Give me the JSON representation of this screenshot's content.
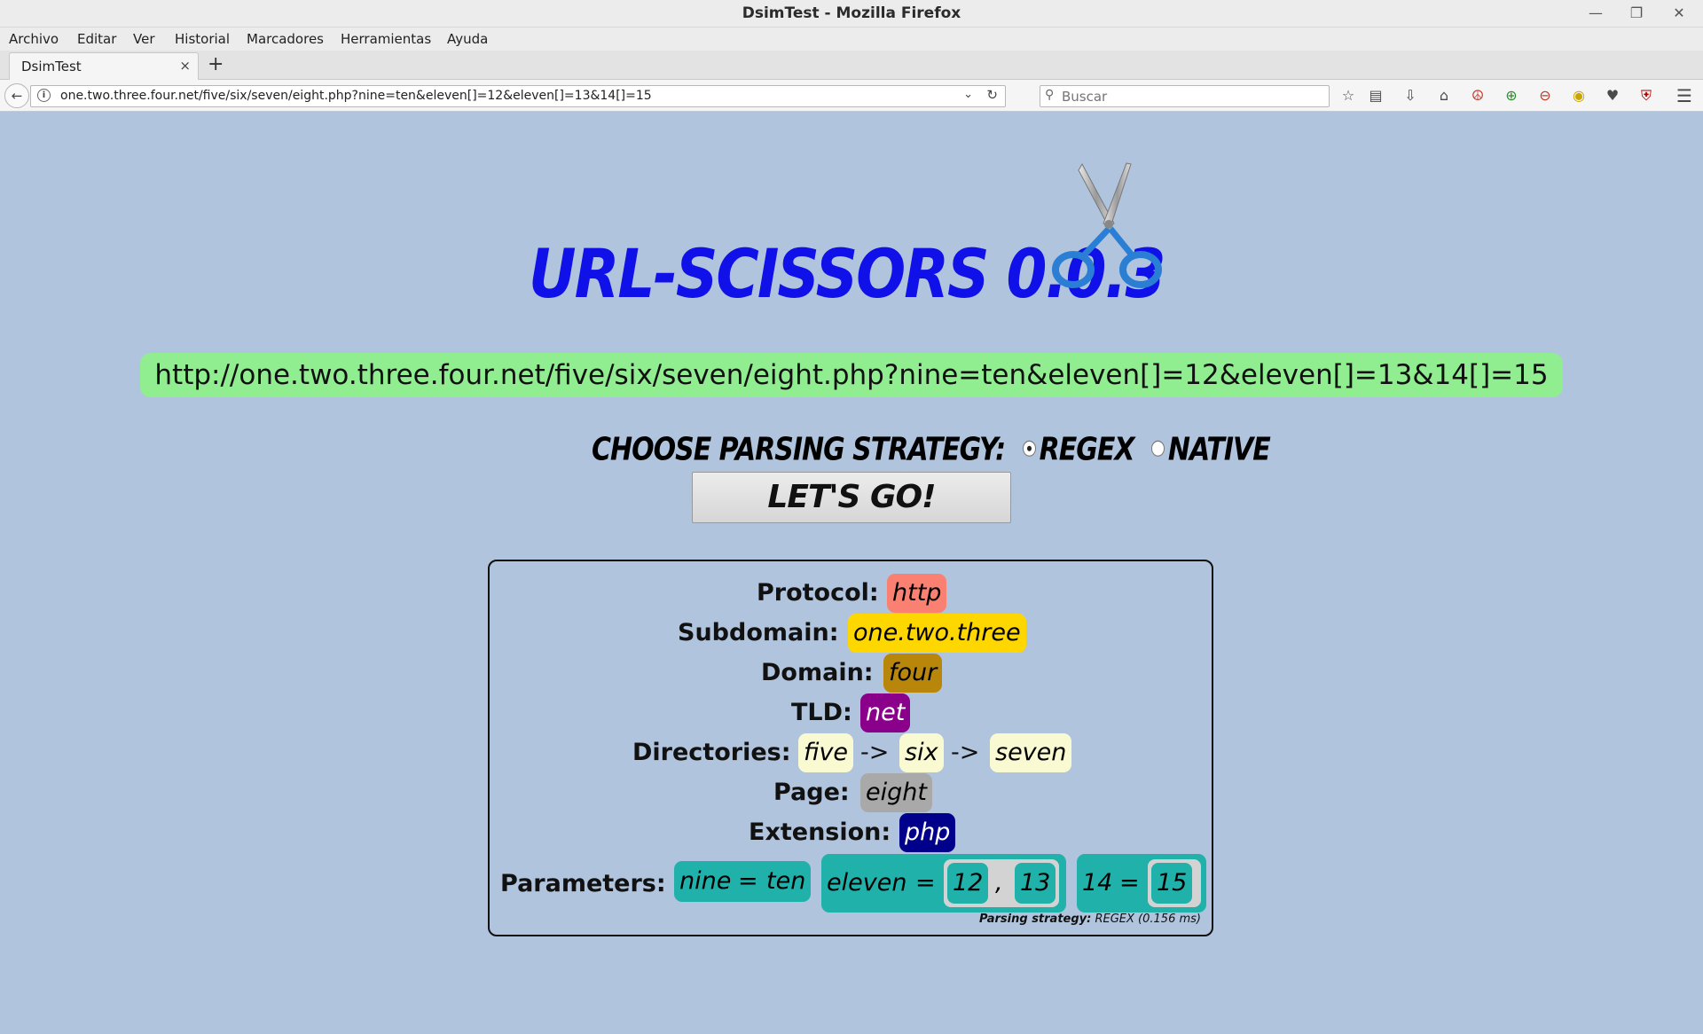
{
  "window": {
    "title": "DsimTest - Mozilla Firefox",
    "minimize": "—",
    "restore": "❐",
    "close": "✕"
  },
  "menu": [
    "Archivo",
    "Editar",
    "Ver",
    "Historial",
    "Marcadores",
    "Herramientas",
    "Ayuda"
  ],
  "tab": {
    "label": "DsimTest",
    "close": "×",
    "new": "+"
  },
  "navbar": {
    "url": "one.two.three.four.net/five/six/seven/eight.php?nine=ten&eleven[]=12&eleven[]=13&14[]=15",
    "search_placeholder": "Buscar"
  },
  "icons": {
    "back": "back-arrow-icon",
    "info": "info-icon",
    "reload": "reload-icon",
    "search": "search-icon",
    "toolbar": [
      "bookmark-star-icon",
      "reading-list-icon",
      "downloads-icon",
      "home-icon",
      "peace-sign-icon",
      "zoom-in-icon",
      "zoom-out-icon",
      "zoom-reset-icon",
      "pocket-icon",
      "ublock-icon",
      "hamburger-menu-icon"
    ]
  },
  "app": {
    "logo": "URL-SCISSORS 0.0.3",
    "full_url": "http://one.two.three.four.net/five/six/seven/eight.php?nine=ten&eleven[]=12&eleven[]=13&14[]=15",
    "strategy_label": "CHOOSE PARSING STRATEGY:",
    "strategy_options": [
      "REGEX",
      "NATIVE"
    ],
    "strategy_selected": "REGEX",
    "go_button": "LET'S GO!"
  },
  "results": {
    "protocol": {
      "label": "Protocol:",
      "value": "http",
      "color": "#fa8072"
    },
    "subdomain": {
      "label": "Subdomain:",
      "value": "one.two.three",
      "color": "#ffd700"
    },
    "domain": {
      "label": "Domain:",
      "value": "four",
      "color": "#b8860b"
    },
    "tld": {
      "label": "TLD:",
      "value": "net",
      "color": "#8b008b"
    },
    "directories": {
      "label": "Directories:",
      "values": [
        "five",
        "six",
        "seven"
      ],
      "separator": "->",
      "color": "#fafad2"
    },
    "page": {
      "label": "Page:",
      "value": "eight",
      "color": "#a9a9a9"
    },
    "extension": {
      "label": "Extension:",
      "value": "php",
      "color": "#00008b"
    },
    "parameters": {
      "label": "Parameters:",
      "color": "#20b2aa",
      "p1": {
        "key": "nine",
        "eq": "=",
        "value": "ten"
      },
      "p2": {
        "key": "eleven",
        "eq": "=",
        "values": [
          "12",
          "13"
        ],
        "sep": ","
      },
      "p3": {
        "key": "14",
        "eq": "=",
        "value": "15"
      }
    },
    "footer": {
      "label": "Parsing strategy:",
      "value": "REGEX (0.156 ms)"
    }
  }
}
